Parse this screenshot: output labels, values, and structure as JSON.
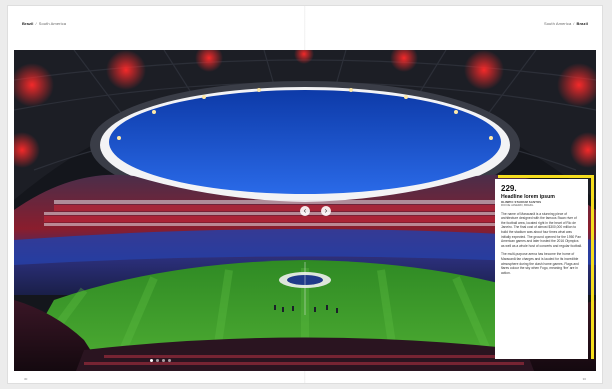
{
  "header": {
    "left": {
      "title": "Brazil",
      "separator": "/",
      "subtitle": "South America"
    },
    "right": {
      "subtitle": "South America",
      "separator": "/",
      "title": "Brazil"
    }
  },
  "photo": {
    "subject": "stadium-image",
    "prev_icon": "‹",
    "next_icon": "›",
    "slides": 4,
    "active_slide": 1
  },
  "infobox": {
    "number": "229.",
    "title": "Headline lorem ipsum",
    "meta": "OLIMPIC STADIUM SANTOS",
    "location": "RIO DE JANEIRO, BRAZIL",
    "paragraph1": "The name of Maracanã is a stunning piece of architecture designed with the famous Swan river of the football area, located right in the heart of Rio de Janeiro. The final cost of almost $300,000 million to build the stadium was about four times what was initially expected. The ground opened for the 1950 Pan American games and later hosted the 2016 Olympics as well as a whole host of concerts and regular football.",
    "paragraph2": "The multi-purpose arena has become the home of Maracanã fan charges and is lauded for its incredible atmosphere during the clash home games. Flags and flares colour the sky when Fogo, meaning 'fire' are in action."
  },
  "folio": {
    "left": "30",
    "right": "30"
  },
  "colors": {
    "accent": "#f5dd1e",
    "sky": "#1f56d6",
    "pitch": "#3f9a2a",
    "roof": "#16181e"
  }
}
